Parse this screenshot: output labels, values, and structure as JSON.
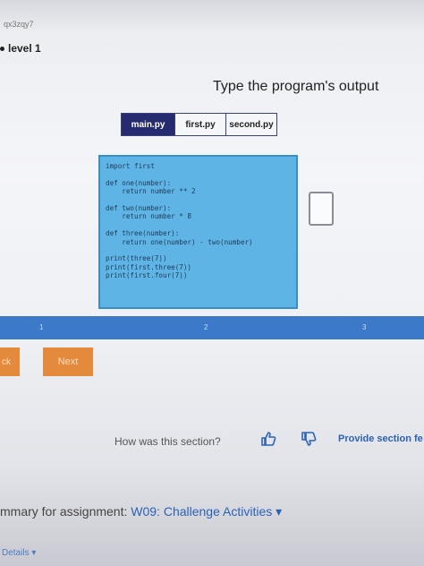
{
  "header": {
    "url_fragment": "qx3zqy7",
    "level_label": "level 1"
  },
  "prompt": "Type the program's output",
  "tabs": [
    {
      "label": "main.py",
      "active": true
    },
    {
      "label": "first.py",
      "active": false
    },
    {
      "label": "second.py",
      "active": false
    }
  ],
  "code": [
    "import first",
    "",
    "def one(number):",
    "    return number ** 2",
    "",
    "def two(number):",
    "    return number * 8",
    "",
    "def three(number):",
    "    return one(number) - two(number)",
    "",
    "print(three(7))",
    "print(first.three(7))",
    "print(first.four(7))"
  ],
  "answer_value": "",
  "progress": {
    "steps": [
      "1",
      "2",
      "3"
    ],
    "color": "#3d79c9"
  },
  "buttons": {
    "back_label": "ck",
    "next_label": "Next",
    "color": "#e48a3c"
  },
  "feedback": {
    "question": "How was this section?",
    "provide_label": "Provide section fe",
    "up_icon": "thumbs-up-icon",
    "down_icon": "thumbs-down-icon"
  },
  "summary": {
    "prefix": "mmary for assignment:",
    "assignment": "W09: Challenge Activities",
    "chevron": "▾"
  },
  "details_label": "Details"
}
